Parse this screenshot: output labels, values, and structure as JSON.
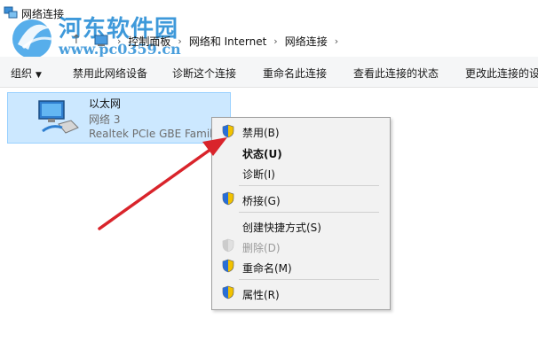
{
  "window": {
    "title": "网络连接"
  },
  "watermark": {
    "text": "河东软件园",
    "url": "www.pc0359.cn"
  },
  "address": {
    "crumbs": [
      "控制面板",
      "网络和 Internet",
      "网络连接"
    ]
  },
  "toolbar": {
    "organize": "组织",
    "disable": "禁用此网络设备",
    "diagnose": "诊断这个连接",
    "rename": "重命名此连接",
    "status": "查看此连接的状态",
    "change": "更改此连接的设"
  },
  "adapter": {
    "name": "以太网",
    "network": "网络 3",
    "device": "Realtek PCIe GBE Family Controller"
  },
  "context_menu": {
    "disable": "禁用(B)",
    "status": "状态(U)",
    "diagnose": "诊断(I)",
    "bridge": "桥接(G)",
    "shortcut": "创建快捷方式(S)",
    "delete": "删除(D)",
    "rename": "重命名(M)",
    "properties": "属性(R)"
  },
  "colors": {
    "selection": "#cce8ff",
    "arrow": "#d9242b",
    "watermark": "#2a8ed6"
  }
}
